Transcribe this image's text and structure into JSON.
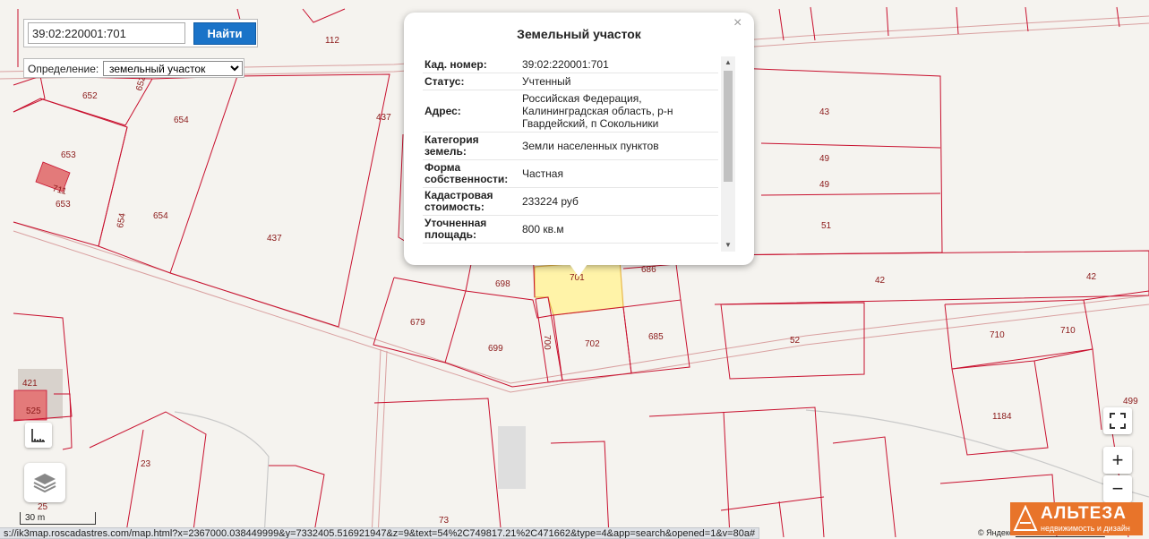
{
  "search": {
    "value": "39:02:220001:701",
    "button_label": "Найти"
  },
  "definition": {
    "label": "Определение:",
    "selected": "земельный участок"
  },
  "popup": {
    "title": "Земельный участок",
    "close_glyph": "×",
    "rows": [
      {
        "key": "Кад. номер:",
        "value": "39:02:220001:701"
      },
      {
        "key": "Статус:",
        "value": "Учтенный"
      },
      {
        "key": "Адрес:",
        "value": "Российская Федерация, Калининградская область, р-н Гвардейский, п Сокольники"
      },
      {
        "key": "Категория земель:",
        "value": "Земли населенных пунктов"
      },
      {
        "key": "Форма собственности:",
        "value": "Частная"
      },
      {
        "key": "Кадастровая стоимость:",
        "value": "233224 руб"
      },
      {
        "key": "Уточненная площадь:",
        "value": "800 кв.м"
      }
    ]
  },
  "map": {
    "parcel_labels": [
      "112",
      "652",
      "652",
      "654",
      "653",
      "711",
      "653",
      "654",
      "654",
      "437",
      "437",
      "43",
      "49",
      "49",
      "51",
      "42",
      "42",
      "698",
      "701",
      "686",
      "679",
      "699",
      "700",
      "702",
      "685",
      "52",
      "710",
      "710",
      "1184",
      "499",
      "421",
      "525",
      "23",
      "25",
      "73"
    ],
    "selected_parcel": "701",
    "colors": {
      "boundary": "#c8102e",
      "selected_fill": "#fff3a8",
      "road": "#d9a0a0"
    }
  },
  "controls": {
    "zoom_in": "+",
    "zoom_out": "−",
    "scale_label": "30 m"
  },
  "status_url": "s://ik3map.roscadastres.com/map.html?x=2367000.038449999&y=7332405.516921947&z=9&text=54%2C749817.21%2C471662&type=4&app=search&opened=1&v=80a#",
  "copyright": {
    "prefix": "© Яндекс",
    "link": "Условия использования"
  },
  "logo": {
    "name": "АЛЬТЕЗА",
    "tagline": "недвижимость и дизайн",
    "color": "#e8742a"
  }
}
